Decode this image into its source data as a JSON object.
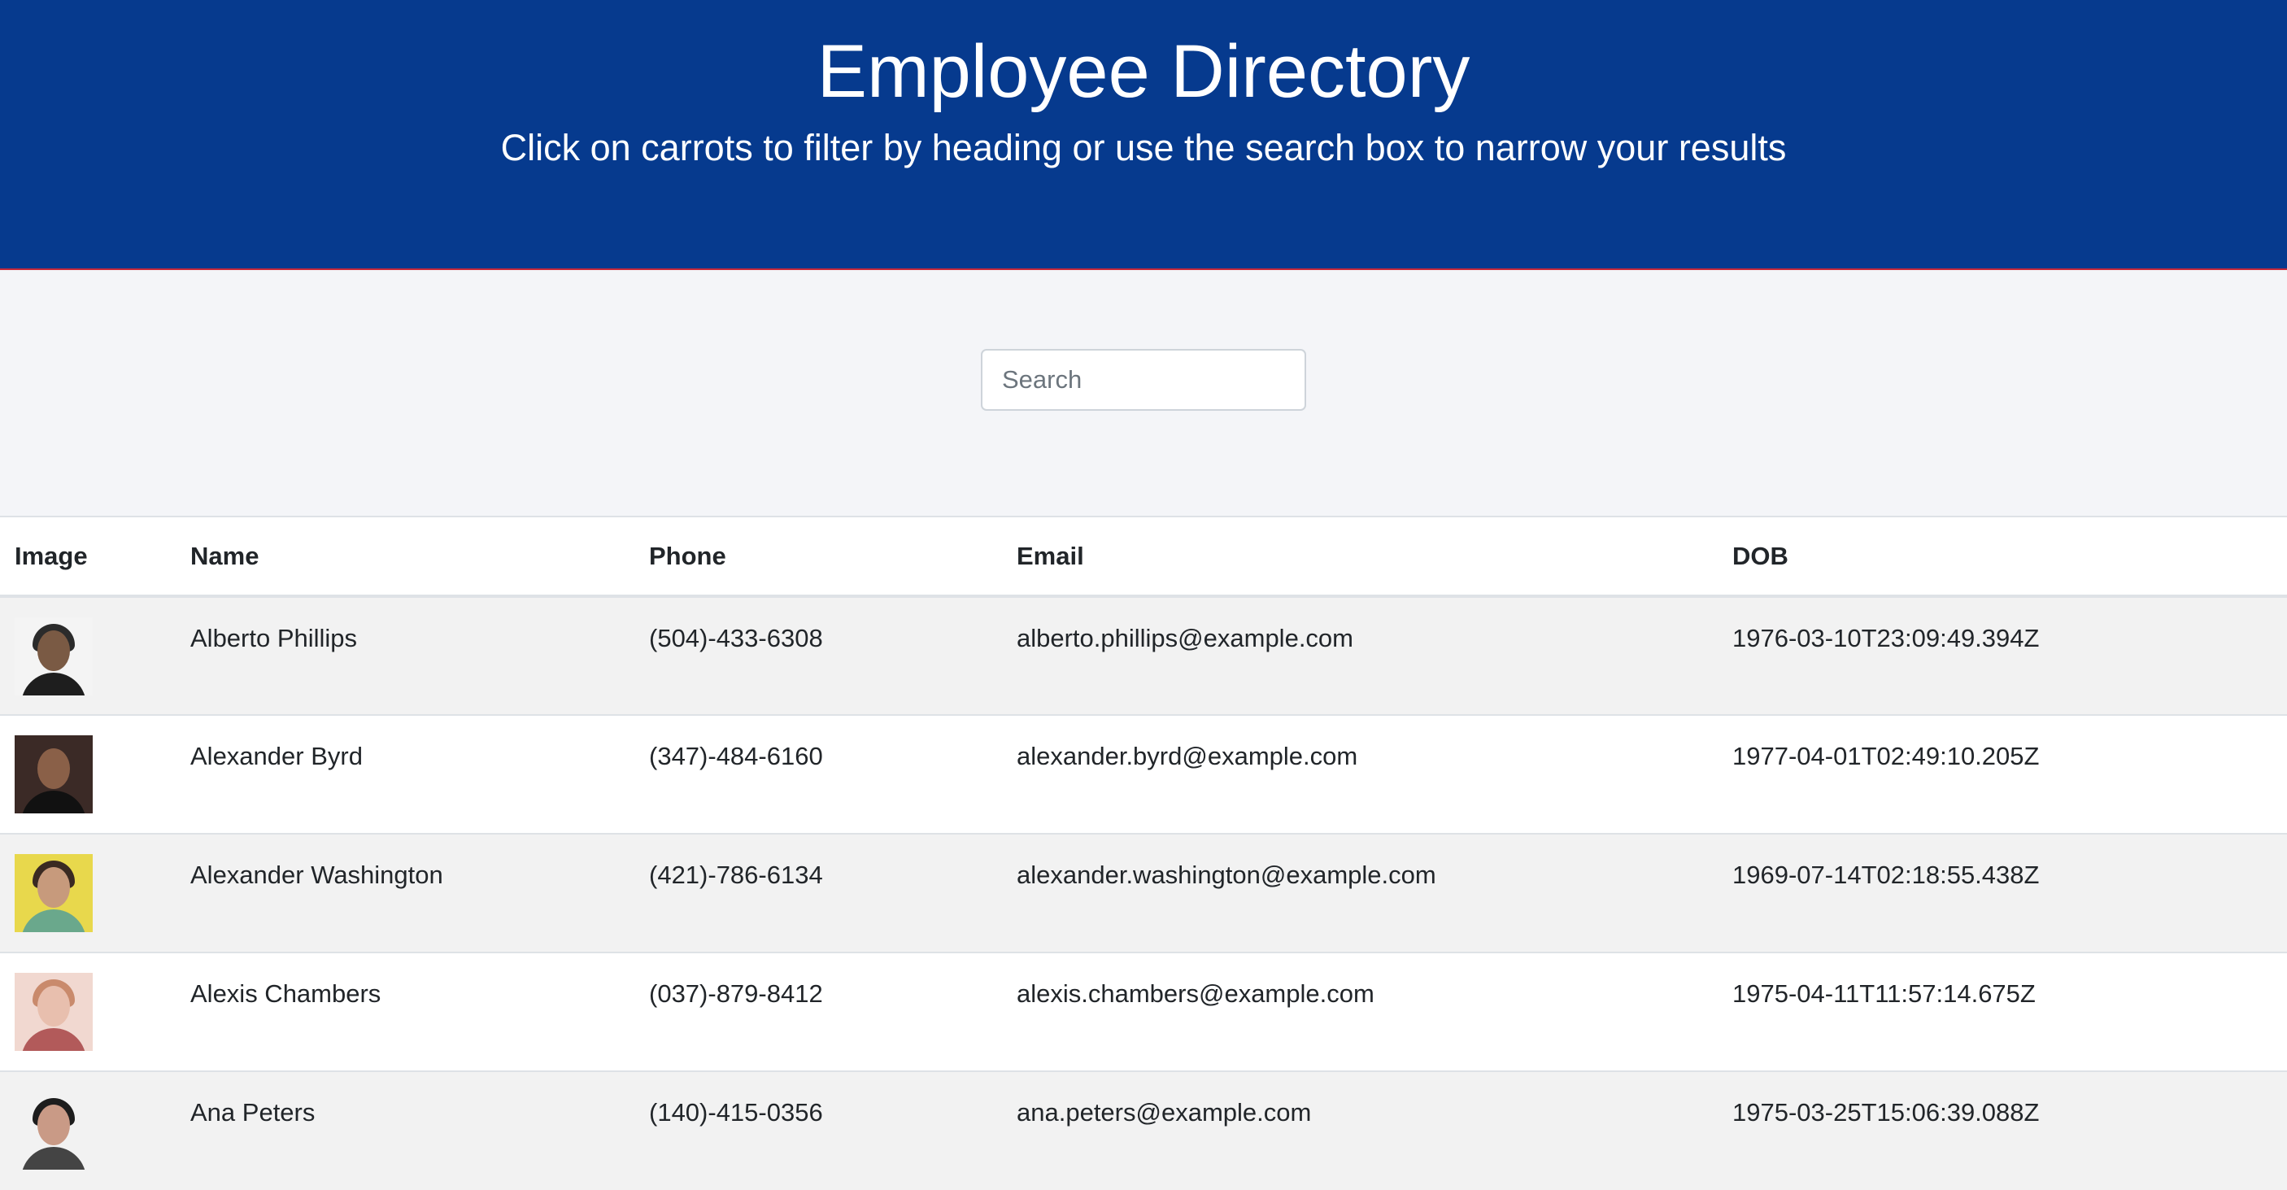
{
  "header": {
    "title": "Employee Directory",
    "subtitle": "Click on carrots to filter by heading or use the search box to narrow your results"
  },
  "search": {
    "placeholder": "Search",
    "value": ""
  },
  "table": {
    "columns": [
      "Image",
      "Name",
      "Phone",
      "Email",
      "DOB"
    ],
    "rows": [
      {
        "avatar": {
          "bg": "#f4f4f4",
          "face": "#7a5a44",
          "hair": "#2b2b2b",
          "shoulders": "#1e1e1e"
        },
        "name": "Alberto Phillips",
        "phone": "(504)-433-6308",
        "email": "alberto.phillips@example.com",
        "dob": "1976-03-10T23:09:49.394Z"
      },
      {
        "avatar": {
          "bg": "#3b2a26",
          "face": "#8a6048",
          "hair": "#3b2a26",
          "shoulders": "#111111"
        },
        "name": "Alexander Byrd",
        "phone": "(347)-484-6160",
        "email": "alexander.byrd@example.com",
        "dob": "1977-04-01T02:49:10.205Z"
      },
      {
        "avatar": {
          "bg": "#e8d84c",
          "face": "#c79a7c",
          "hair": "#3a2a22",
          "shoulders": "#6aa88c"
        },
        "name": "Alexander Washington",
        "phone": "(421)-786-6134",
        "email": "alexander.washington@example.com",
        "dob": "1969-07-14T02:18:55.438Z"
      },
      {
        "avatar": {
          "bg": "#f1d8d0",
          "face": "#e8bfae",
          "hair": "#c98a6c",
          "shoulders": "#b25a5a"
        },
        "name": "Alexis Chambers",
        "phone": "(037)-879-8412",
        "email": "alexis.chambers@example.com",
        "dob": "1975-04-11T11:57:14.675Z"
      },
      {
        "avatar": {
          "bg": "#f2f2f2",
          "face": "#c99a86",
          "hair": "#1d1d1d",
          "shoulders": "#444444"
        },
        "name": "Ana Peters",
        "phone": "(140)-415-0356",
        "email": "ana.peters@example.com",
        "dob": "1975-03-25T15:06:39.088Z"
      }
    ]
  },
  "colors": {
    "header_bg": "#063a8e",
    "header_border": "#c62a3a",
    "page_bg": "#f4f5f8"
  }
}
